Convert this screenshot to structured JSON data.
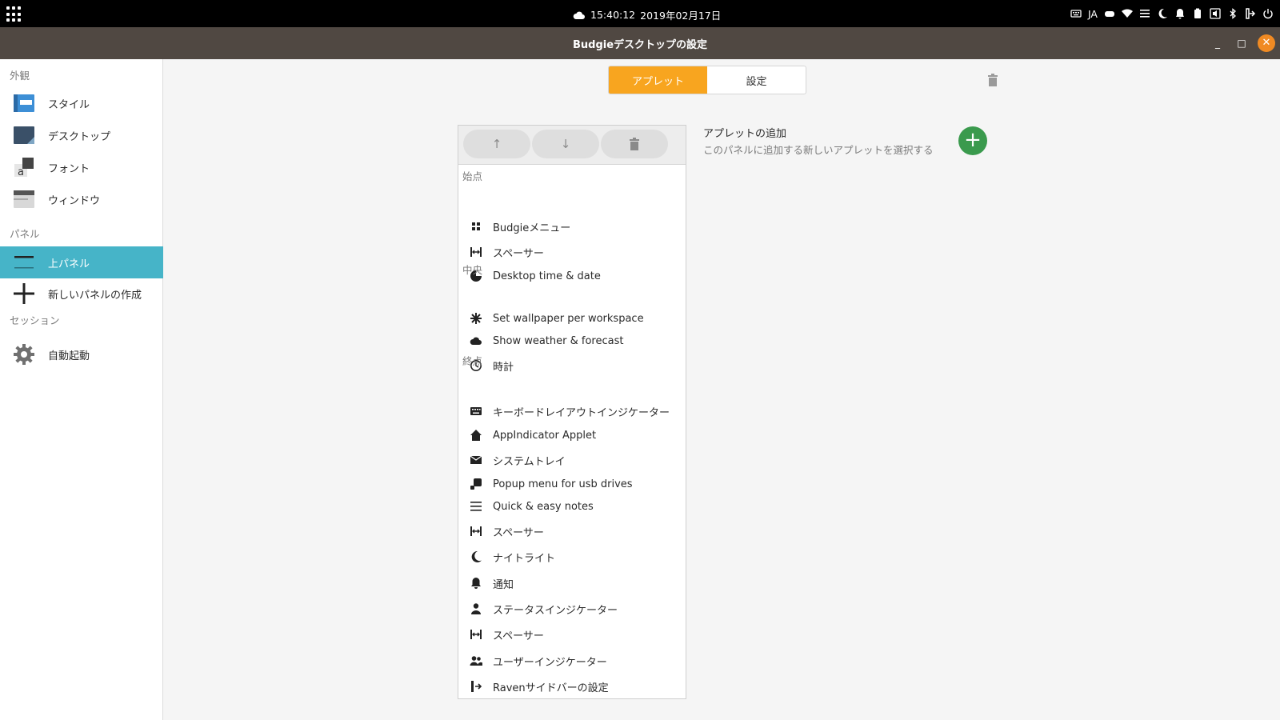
{
  "top_panel": {
    "time": "15:40:12",
    "date": "2019年02月17日",
    "keyboard_layout": "JA"
  },
  "window": {
    "title": "Budgieデスクトップの設定",
    "minimize_label": "_",
    "maximize_label": "□",
    "close_label": "✕"
  },
  "sidebar": {
    "headers": [
      "外観",
      "パネル",
      "セッション"
    ],
    "items": [
      {
        "label": "スタイル"
      },
      {
        "label": "デスクトップ"
      },
      {
        "label": "フォント"
      },
      {
        "label": "ウィンドウ"
      },
      {
        "label": "上パネル",
        "selected": true
      },
      {
        "label": "新しいパネルの作成"
      },
      {
        "label": "自動起動"
      }
    ]
  },
  "tabs": [
    {
      "label": "アプレット",
      "active": true
    },
    {
      "label": "設定",
      "active": false
    }
  ],
  "toolbar": {
    "up_label": "↑",
    "down_label": "↓"
  },
  "groups": {
    "start": "始点",
    "center": "中央",
    "end": "終点"
  },
  "applets": {
    "start": [
      {
        "label": "Budgieメニュー",
        "icon": "grid-icon"
      },
      {
        "label": "スペーサー",
        "icon": "spacer-icon"
      },
      {
        "label": "Desktop time & date",
        "icon": "clock-pie-icon"
      }
    ],
    "center": [
      {
        "label": "Set wallpaper per workspace",
        "icon": "asterisk-icon"
      },
      {
        "label": "Show weather & forecast",
        "icon": "cloud-icon"
      },
      {
        "label": "時計",
        "icon": "clock-icon"
      }
    ],
    "end": [
      {
        "label": "キーボードレイアウトインジケーター",
        "icon": "keyboard-icon"
      },
      {
        "label": "AppIndicator Applet",
        "icon": "home-icon"
      },
      {
        "label": "システムトレイ",
        "icon": "envelope-icon"
      },
      {
        "label": "Popup menu for usb drives",
        "icon": "usb-drive-icon"
      },
      {
        "label": "Quick & easy notes",
        "icon": "list-icon"
      },
      {
        "label": "スペーサー",
        "icon": "spacer-icon"
      },
      {
        "label": "ナイトライト",
        "icon": "moon-icon"
      },
      {
        "label": "通知",
        "icon": "bell-icon"
      },
      {
        "label": "ステータスインジケーター",
        "icon": "person-icon"
      },
      {
        "label": "スペーサー",
        "icon": "spacer-icon"
      },
      {
        "label": "ユーザーインジケーター",
        "icon": "users-icon"
      },
      {
        "label": "Ravenサイドバーの設定",
        "icon": "raven-icon"
      }
    ]
  },
  "add_applet": {
    "title": "アプレットの追加",
    "description": "このパネルに追加する新しいアプレットを選択する",
    "button_label": "+"
  },
  "colors": {
    "accent_orange": "#f8a51f",
    "selected_teal": "#46b4c8",
    "add_green": "#3a9a4d",
    "titlebar": "#504842"
  }
}
